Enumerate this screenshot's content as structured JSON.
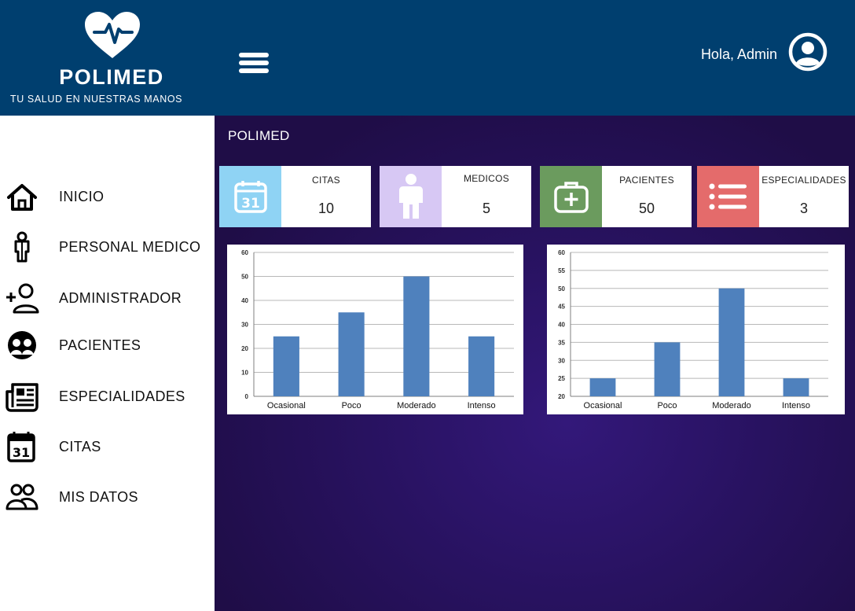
{
  "brand": {
    "name": "POLIMED",
    "tagline": "TU SALUD EN NUESTRAS MANOS"
  },
  "header": {
    "greeting": "Hola, Admin",
    "menu_icon": "hamburger-icon",
    "avatar_icon": "user-circle-icon"
  },
  "sidebar": {
    "items": [
      {
        "label": "INICIO",
        "icon": "home-icon"
      },
      {
        "label": "PERSONAL MEDICO",
        "icon": "doctor-icon"
      },
      {
        "label": "ADMINISTRADOR",
        "icon": "add-user-icon"
      },
      {
        "label": "PACIENTES",
        "icon": "patients-icon"
      },
      {
        "label": "ESPECIALIDADES",
        "icon": "newspaper-icon"
      },
      {
        "label": "CITAS",
        "icon": "calendar-icon"
      },
      {
        "label": "MIS DATOS",
        "icon": "users-icon"
      }
    ]
  },
  "main": {
    "title": "POLIMED",
    "cards": [
      {
        "label": "CITAS",
        "value": "10",
        "color": "#8fd3f4",
        "icon": "calendar-icon"
      },
      {
        "label": "MEDICOS",
        "value": "5",
        "color": "#d7c8f4",
        "icon": "person-icon"
      },
      {
        "label": "PACIENTES",
        "value": "50",
        "color": "#6b9b5e",
        "icon": "first-aid-kit-icon"
      },
      {
        "label": "ESPECIALIDADES",
        "value": "3",
        "color": "#e46b6b",
        "icon": "list-icon"
      }
    ]
  },
  "colors": {
    "header": "#003f6f",
    "bar": "#4f81bd",
    "main_bg": "#281260"
  },
  "chart_data": [
    {
      "type": "bar",
      "categories": [
        "Ocasional",
        "Poco",
        "Moderado",
        "Intenso"
      ],
      "values": [
        25,
        35,
        50,
        25
      ],
      "ylim": [
        0,
        60
      ],
      "yticks": [
        0,
        10,
        20,
        30,
        40,
        50,
        60
      ],
      "grid": true
    },
    {
      "type": "bar",
      "categories": [
        "Ocasional",
        "Poco",
        "Moderado",
        "Intenso"
      ],
      "values": [
        25,
        35,
        50,
        25
      ],
      "ylim": [
        20,
        60
      ],
      "yticks": [
        20,
        25,
        30,
        35,
        40,
        45,
        50,
        55,
        60
      ],
      "grid": true
    }
  ]
}
